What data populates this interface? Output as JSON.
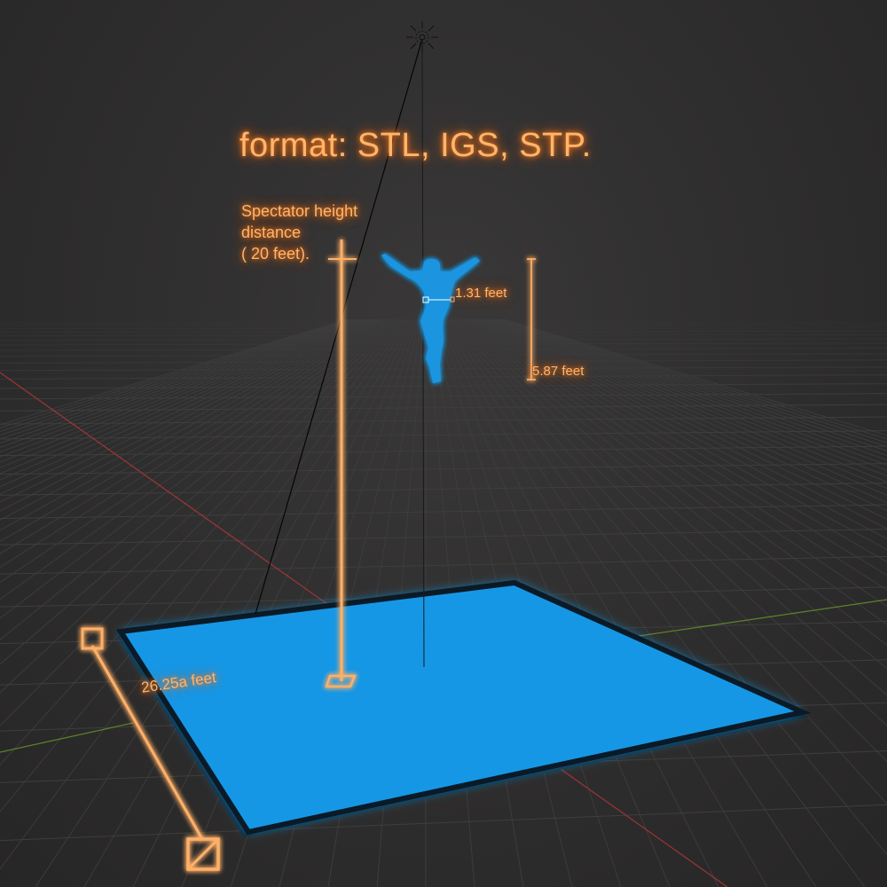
{
  "viewport": {
    "background": "#2a2929",
    "grid_color": "#3f3e3e",
    "x_axis_color": "#b8383c",
    "y_axis_color": "#6a9a2a",
    "accent_color": "#ff8a2a",
    "plane_color": "#1597e6"
  },
  "annotations": {
    "title": "format: STL, IGS, STP.",
    "spectator_line1": "Spectator height",
    "spectator_line2": "distance",
    "spectator_line3": "( 20 feet).",
    "figure_width": "1.31 feet",
    "figure_height": "5.87 feet",
    "plane_size": "26.25a feet"
  },
  "icons": {
    "light": "sun-light-icon",
    "figure": "human-silhouette-icon"
  }
}
